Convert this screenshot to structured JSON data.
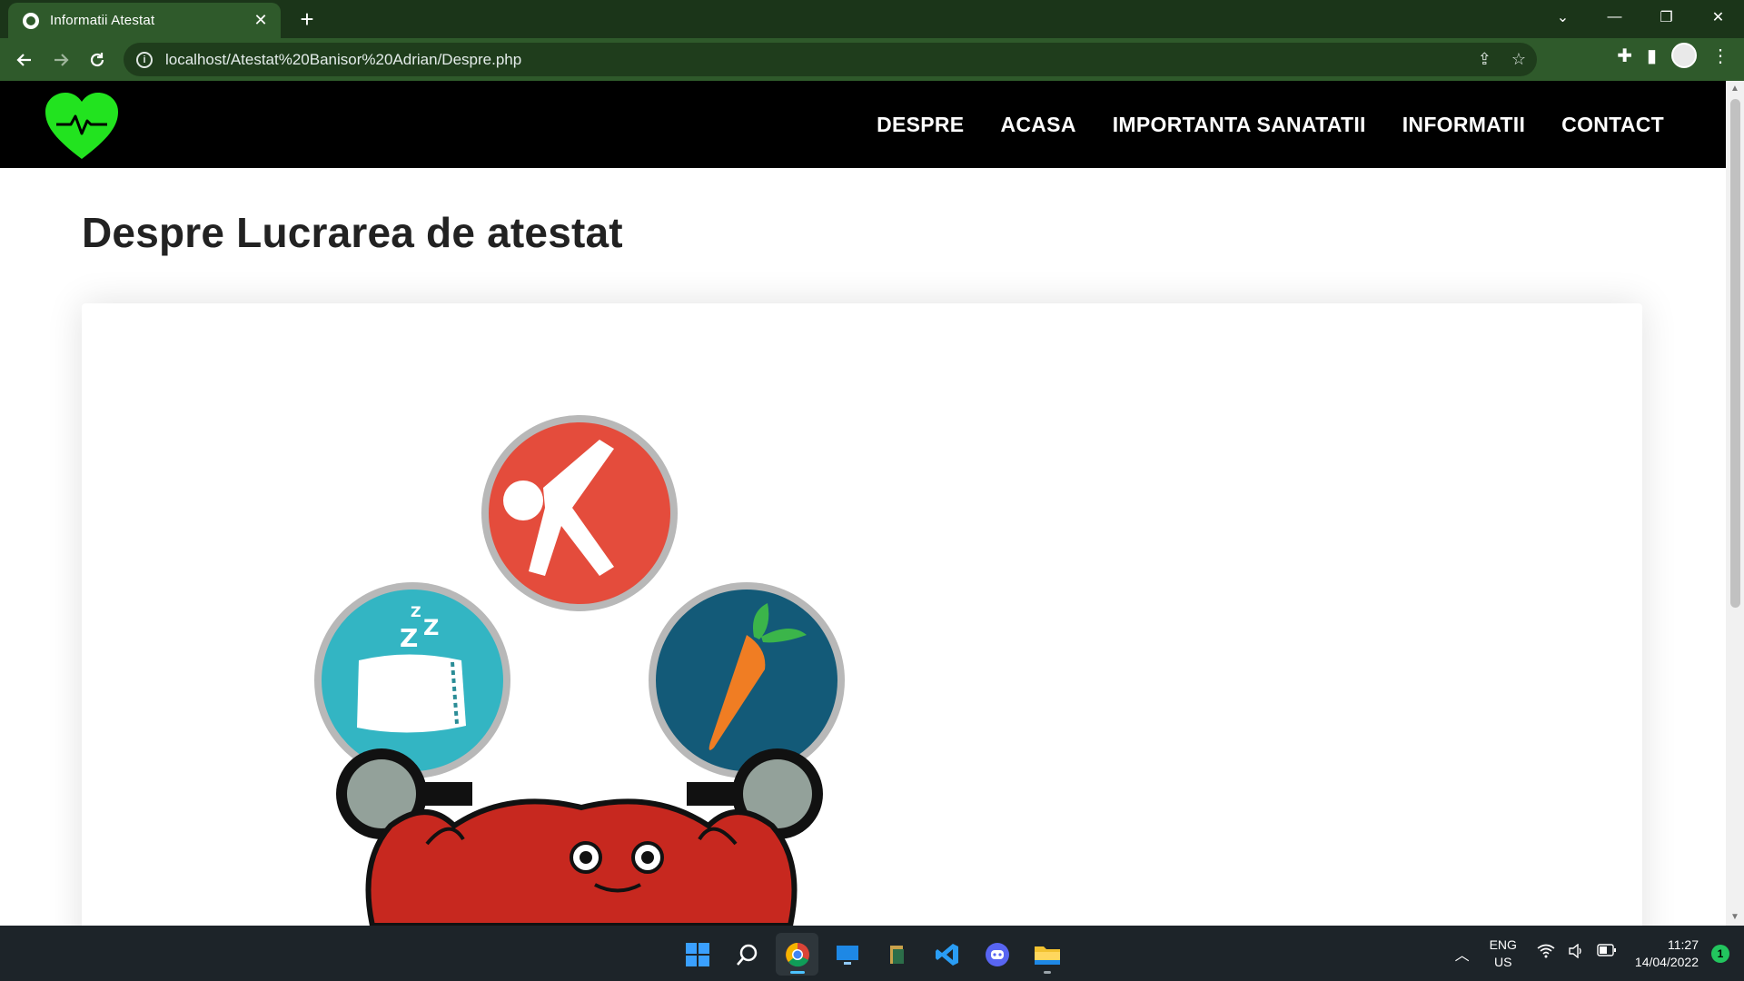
{
  "browser": {
    "tab_title": "Informatii Atestat",
    "tab_close": "✕",
    "new_tab": "+",
    "url": "localhost/Atestat%20Banisor%20Adrian/Despre.php",
    "window_controls": {
      "menu": "⌄",
      "minimize": "—",
      "restore": "❐",
      "close": "✕"
    }
  },
  "site": {
    "menu": [
      "DESPRE",
      "ACASA",
      "IMPORTANTA SANATATII",
      "INFORMATII",
      "CONTACT"
    ],
    "heading": "Despre Lucrarea de atestat",
    "colors": {
      "header_bg": "#000000",
      "logo_green": "#22e31f",
      "text": "#222222"
    }
  },
  "taskbar": {
    "lang_line1": "ENG",
    "lang_line2": "US",
    "time": "11:27",
    "date": "14/04/2022",
    "notification_count": "1",
    "apps": [
      "windows-start",
      "search",
      "chrome",
      "remote-desktop",
      "files-app",
      "vscode",
      "discord",
      "file-explorer"
    ]
  }
}
